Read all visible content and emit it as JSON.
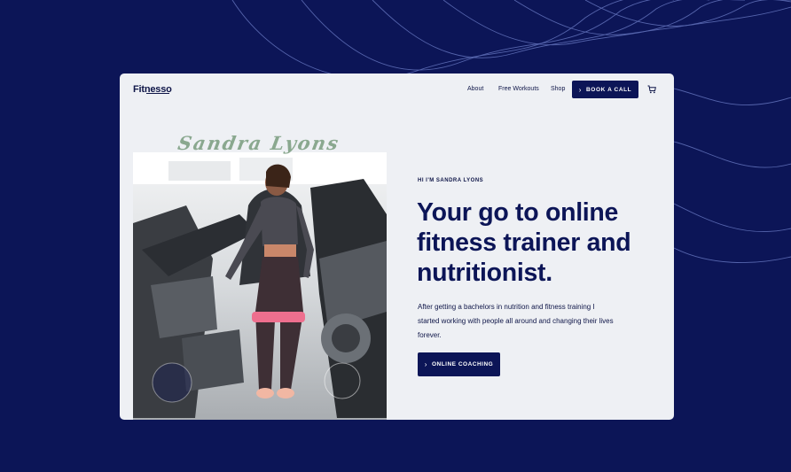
{
  "brand": {
    "logo_text": "Fitnesso"
  },
  "nav": {
    "links": [
      "About",
      "Free Workouts",
      "Shop"
    ],
    "cta_label": "BOOK A CALL",
    "cart_icon": "cart-icon"
  },
  "hero": {
    "signature": "Sandra Lyons",
    "eyebrow": "HI I'M SANDRA LYONS",
    "headline": "Your go to online fitness trainer and nutritionist.",
    "body": "After getting a bachelors in nutrition and fitness training I started working with people all around and changing their lives forever.",
    "cta_label": "ONLINE COACHING"
  },
  "colors": {
    "background": "#0c1557",
    "card": "#eef0f4",
    "accent": "#0c1557",
    "signature": "#8aa88f"
  }
}
